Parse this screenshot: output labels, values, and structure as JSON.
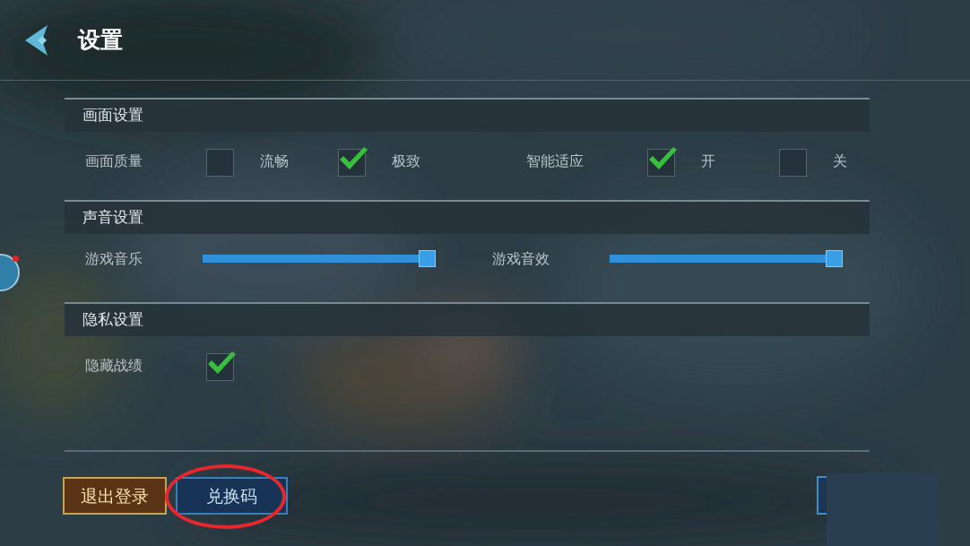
{
  "header": {
    "title": "设置"
  },
  "floating_ball": {
    "notification": true
  },
  "sections": [
    {
      "title": "画面设置",
      "items": [
        {
          "kind": "choice",
          "label": "画面质量",
          "options": [
            {
              "label": "流畅",
              "checked": false
            },
            {
              "label": "极致",
              "checked": true
            }
          ]
        },
        {
          "kind": "choice",
          "label": "智能适应",
          "options": [
            {
              "label": "开",
              "checked": true
            },
            {
              "label": "关",
              "checked": false
            }
          ]
        }
      ]
    },
    {
      "title": "声音设置",
      "items": [
        {
          "kind": "slider",
          "label": "游戏音乐",
          "level": 1
        },
        {
          "kind": "slider",
          "label": "游戏音效",
          "level": 1
        }
      ]
    },
    {
      "title": "隐私设置",
      "items": [
        {
          "kind": "toggle",
          "label": "隐藏战绩",
          "checked": true
        }
      ]
    }
  ],
  "buttons": [
    {
      "label": "退出登录",
      "circled": false
    },
    {
      "label": "兑换码",
      "circled": true
    }
  ]
}
